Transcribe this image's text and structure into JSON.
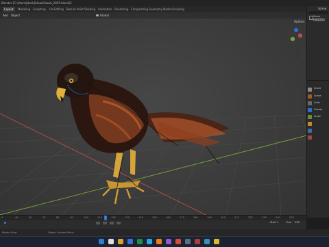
{
  "window": {
    "title": "Blender [C:\\Users\\[desk]\\Hawk\\Hawk_2015.blend2]"
  },
  "workspace_tabs": [
    "Layout",
    "Modeling",
    "Sculpting",
    "UV Editing",
    "Texture Paint",
    "Shading",
    "Animation",
    "Rendering",
    "Compositing",
    "Geometry Nodes",
    "Scripting"
  ],
  "active_tab": "Layout",
  "viewport": {
    "menu": [
      "Add",
      "Object"
    ],
    "transform_orientation": "Global",
    "options_label": "Options"
  },
  "outliner": {
    "search_label": "Scene",
    "rows": [
      "Scene Collection",
      "Collection"
    ]
  },
  "properties": {
    "header": "Scene",
    "rows": [
      "Scene",
      "Units",
      "Gravity",
      "Audio"
    ]
  },
  "timeline": {
    "ticks": [
      "0",
      "40",
      "60",
      "70",
      "80",
      "90",
      "100",
      "110",
      "120",
      "130",
      "140",
      "150",
      "160",
      "170",
      "180",
      "190",
      "200",
      "210",
      "220",
      "230",
      "240",
      "250"
    ],
    "current_frame": "1",
    "start_label": "Start",
    "start_value": "1",
    "end_label": "End",
    "end_value": "250"
  },
  "statusbar": {
    "left": "Rotate View",
    "center": "Object Context Menu"
  },
  "colors": {
    "accent": "#2d6fd1",
    "x_axis": "#c24d4d",
    "y_axis": "#7aa83f",
    "grid": "#545454"
  }
}
